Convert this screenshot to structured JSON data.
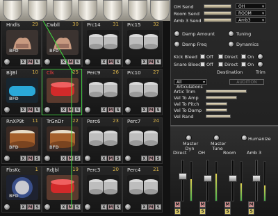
{
  "kit_cells": [
    {
      "name": "Hndls",
      "num": "29",
      "thumb": "hand",
      "bfd": "BFD",
      "red": false
    },
    {
      "name": "Cwbll",
      "num": "30",
      "thumb": "hand",
      "bfd": "BFD",
      "red": false
    },
    {
      "name": "Prc14",
      "num": "31",
      "thumb": "toms",
      "bfd": "",
      "red": false
    },
    {
      "name": "Prc15",
      "num": "32",
      "thumb": "toms",
      "bfd": "",
      "red": false
    },
    {
      "name": "BlJBl",
      "num": "10",
      "thumb": "cyan",
      "bfd": "BFD",
      "red": false
    },
    {
      "name": "Clk",
      "num": "25",
      "thumb": "red",
      "bfd": "",
      "red": true
    },
    {
      "name": "Perc9",
      "num": "26",
      "thumb": "toms",
      "bfd": "",
      "red": false
    },
    {
      "name": "Prc10",
      "num": "27",
      "thumb": "toms",
      "bfd": "",
      "red": false
    },
    {
      "name": "RnXP9t",
      "num": "11",
      "thumb": "drum",
      "bfd": "BFD",
      "red": false
    },
    {
      "name": "TrGnDr",
      "num": "22",
      "thumb": "drum",
      "bfd": "BFD",
      "red": false
    },
    {
      "name": "Perc6",
      "num": "23",
      "thumb": "toms",
      "bfd": "",
      "red": false
    },
    {
      "name": "Perc7",
      "num": "24",
      "thumb": "toms",
      "bfd": "",
      "red": false
    },
    {
      "name": "FbsKc",
      "num": "1",
      "thumb": "kick",
      "bfd": "BFD",
      "red": false
    },
    {
      "name": "RdJbl",
      "num": "19",
      "thumb": "red",
      "bfd": "",
      "red": false
    },
    {
      "name": "Perc3",
      "num": "20",
      "thumb": "toms",
      "bfd": "",
      "red": false
    },
    {
      "name": "Perc4",
      "num": "21",
      "thumb": "toms",
      "bfd": "",
      "red": false
    }
  ],
  "buttons": {
    "x": "X",
    "m": "M",
    "s": "S"
  },
  "sends": [
    {
      "label": "OH Send",
      "value": 0.55,
      "dest": "OH"
    },
    {
      "label": "Room Send",
      "value": 0.55,
      "dest": "ROOM"
    },
    {
      "label": "Amb 3 Send",
      "value": 0.55,
      "dest": "Amb3"
    }
  ],
  "knobs": {
    "damp_amount": "Damp Amount",
    "tuning": "Tuning",
    "damp_freq": "Damp Freq",
    "dynamics": "Dynamics"
  },
  "bleed": {
    "kick": "Kick Bleed",
    "snare": "Snare Bleed",
    "off": "Off",
    "direct": "Direct",
    "on": "On",
    "destination": "Destination",
    "trim": "Trim"
  },
  "articulations": {
    "select": "All Articulations",
    "audition": "AUDITION"
  },
  "params": [
    {
      "label": "Artic Trim",
      "value": 0.65
    },
    {
      "label": "Vel To Amp",
      "value": 0.5
    },
    {
      "label": "Vel To Pitch",
      "value": 0.35
    },
    {
      "label": "Vel To Damp",
      "value": 0.35
    },
    {
      "label": "Vel Rand",
      "value": 0.4
    }
  ],
  "mixer": {
    "knob_labels": [
      "Master Dyn",
      "Master Tune",
      "Humanize"
    ],
    "channels": [
      {
        "label": "Direct",
        "fader": 0.62,
        "meter": 0.55
      },
      {
        "label": "OH",
        "fader": 0.55,
        "meter": 0.7
      },
      {
        "label": "Room",
        "fader": 0.55,
        "meter": 0.45
      },
      {
        "label": "Amb 3",
        "fader": 0.55,
        "meter": 0.4
      }
    ],
    "m": "M",
    "s": "S"
  },
  "colors": {
    "accent": "#3fbf3f",
    "number": "#d8b24a",
    "selected_name": "#ff4040"
  }
}
